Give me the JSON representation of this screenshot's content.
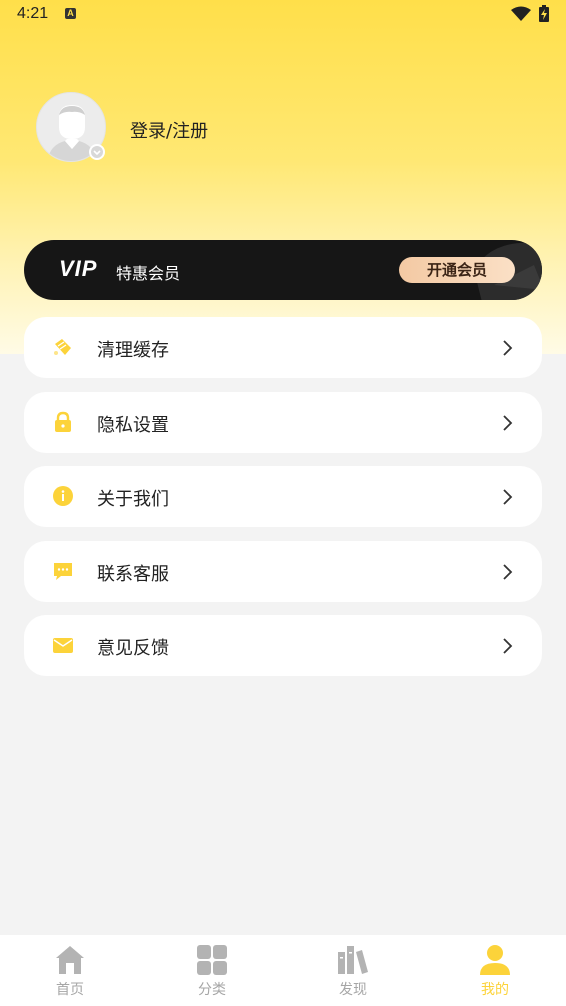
{
  "status_bar": {
    "time": "4:21",
    "notification_letter": "A"
  },
  "profile": {
    "login_label": "登录/注册"
  },
  "vip": {
    "logo": "VIP",
    "title": "特惠会员",
    "button_label": "开通会员"
  },
  "menu": [
    {
      "label": "清理缓存",
      "icon": "broom-icon"
    },
    {
      "label": "隐私设置",
      "icon": "lock-icon"
    },
    {
      "label": "关于我们",
      "icon": "info-icon"
    },
    {
      "label": "联系客服",
      "icon": "chat-icon"
    },
    {
      "label": "意见反馈",
      "icon": "mail-icon"
    }
  ],
  "tabbar": [
    {
      "label": "首页",
      "icon": "home-icon",
      "active": false
    },
    {
      "label": "分类",
      "icon": "grid-icon",
      "active": false
    },
    {
      "label": "发现",
      "icon": "books-icon",
      "active": false
    },
    {
      "label": "我的",
      "icon": "user-icon",
      "active": true
    }
  ],
  "colors": {
    "accent": "#FCD33A",
    "inactive": "#A6A6A6",
    "vip_bg": "#161616"
  }
}
